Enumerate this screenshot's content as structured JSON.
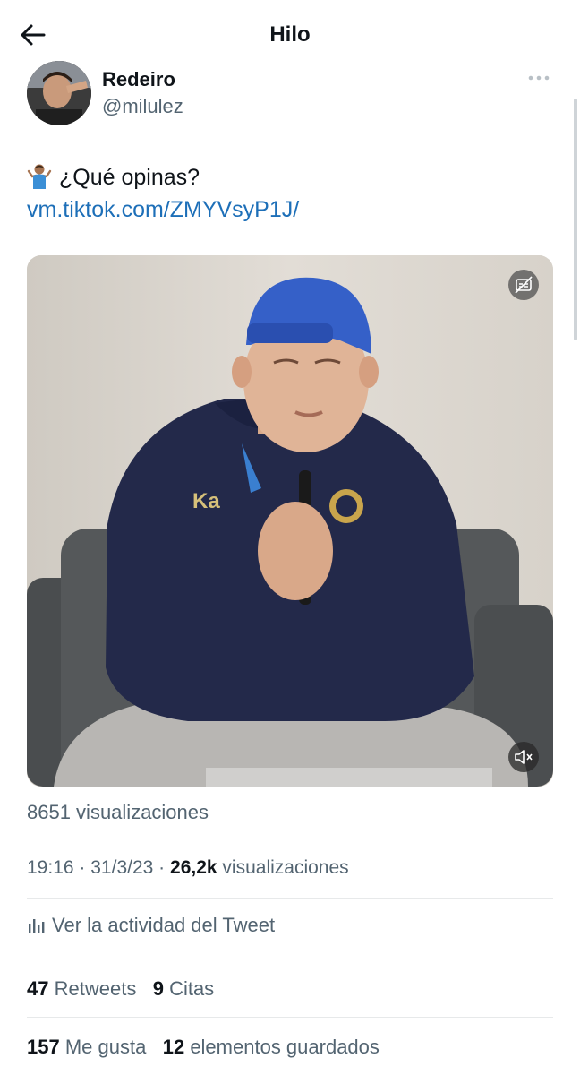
{
  "header": {
    "title": "Hilo",
    "back_icon": "arrow-left-icon"
  },
  "author": {
    "display_name": "Redeiro",
    "handle": "@milulez",
    "more_icon": "more-horizontal-icon"
  },
  "tweet": {
    "emoji": "🤷🏽‍♂️",
    "text": "¿Qué opinas?",
    "link": "vm.tiktok.com/ZMYVsyP1J/"
  },
  "video": {
    "views_label": "8651 visualizaciones",
    "captions_icon": "captions-off-icon",
    "mute_icon": "volume-muted-icon"
  },
  "meta": {
    "time": "19:16",
    "date": "31/3/23",
    "views_count": "26,2k",
    "views_label": "visualizaciones",
    "separator": "·"
  },
  "activity": {
    "icon": "analytics-bars-icon",
    "label": "Ver la actividad del Tweet"
  },
  "stats": {
    "retweets": {
      "count": "47",
      "label": "Retweets"
    },
    "quotes": {
      "count": "9",
      "label": "Citas"
    },
    "likes": {
      "count": "157",
      "label": "Me gusta"
    },
    "bookmarks": {
      "count": "12",
      "label": "elementos guardados"
    }
  },
  "colors": {
    "link": "#1d6fb8",
    "secondary_text": "#536471",
    "primary_text": "#0f1419",
    "divider": "#e7e9ea"
  }
}
